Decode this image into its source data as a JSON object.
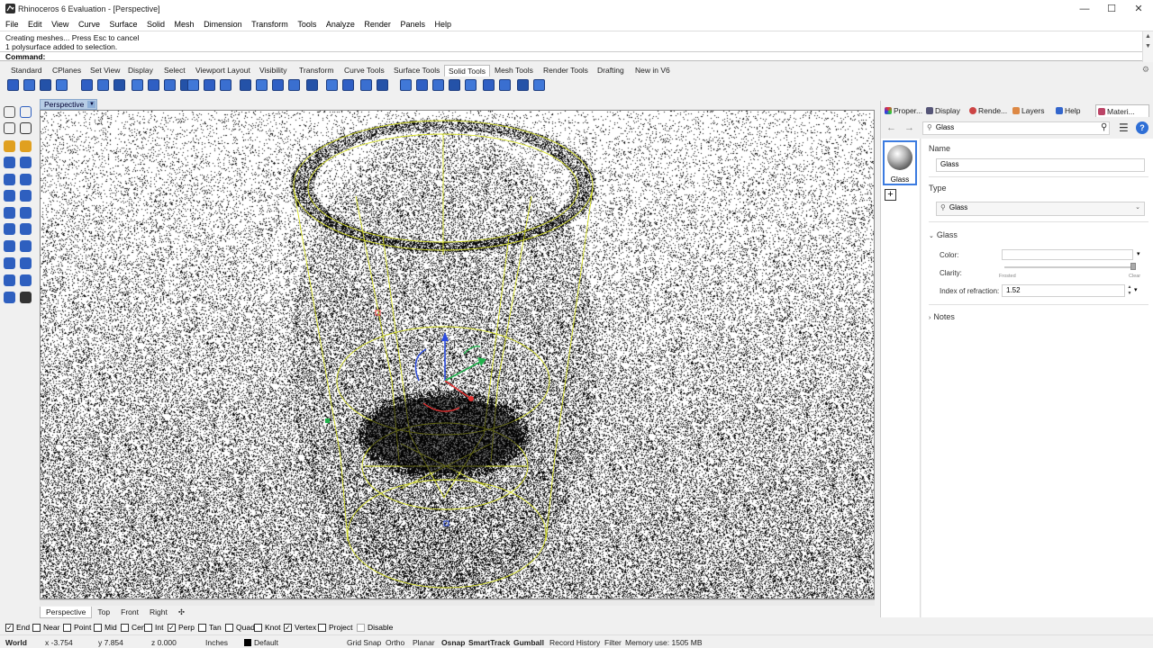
{
  "window": {
    "title": "Rhinoceros 6 Evaluation - [Perspective]",
    "controls": {
      "minimize": "—",
      "maximize": "☐",
      "close": "✕"
    }
  },
  "menu": [
    "File",
    "Edit",
    "View",
    "Curve",
    "Surface",
    "Solid",
    "Mesh",
    "Dimension",
    "Transform",
    "Tools",
    "Analyze",
    "Render",
    "Panels",
    "Help"
  ],
  "command_history": {
    "line1": "Creating meshes... Press Esc to cancel",
    "line2": "1 polysurface added to selection.",
    "prompt": "Command:"
  },
  "toolbar_tabs": {
    "items": [
      "Standard",
      "CPlanes",
      "Set View",
      "Display",
      "Select",
      "Viewport Layout",
      "Visibility",
      "Transform",
      "Curve Tools",
      "Surface Tools",
      "Solid Tools",
      "Mesh Tools",
      "Render Tools",
      "Drafting",
      "New in V6"
    ],
    "active": "Solid Tools"
  },
  "viewport": {
    "label": "Perspective",
    "dropdown": "▼",
    "bottom_tabs": [
      "Perspective",
      "Top",
      "Front",
      "Right"
    ],
    "add_tab": "✣"
  },
  "panel": {
    "tabs": [
      "Proper...",
      "Display",
      "Rende...",
      "Layers",
      "Help",
      "Materi..."
    ],
    "active_tab": "Materi...",
    "toolbar": {
      "back": "←",
      "forward": "→",
      "search_value": "Glass"
    },
    "material_thumbnail_label": "Glass",
    "add_button": "+",
    "name_section_label": "Name",
    "name_value": "Glass",
    "type_section_label": "Type",
    "type_value": "Glass",
    "glass_section_label": "Glass",
    "color_label": "Color:",
    "clarity_label": "Clarity:",
    "clarity_min_label": "Frosted",
    "clarity_max_label": "Clear",
    "ior_label": "Index of refraction:",
    "ior_value": "1.52",
    "notes_label": "Notes"
  },
  "osnaps": [
    {
      "label": "End",
      "checked": true
    },
    {
      "label": "Near",
      "checked": false
    },
    {
      "label": "Point",
      "checked": false
    },
    {
      "label": "Mid",
      "checked": false
    },
    {
      "label": "Cen",
      "checked": false
    },
    {
      "label": "Int",
      "checked": false
    },
    {
      "label": "Perp",
      "checked": true
    },
    {
      "label": "Tan",
      "checked": false
    },
    {
      "label": "Quad",
      "checked": false
    },
    {
      "label": "Knot",
      "checked": false
    },
    {
      "label": "Vertex",
      "checked": true
    },
    {
      "label": "Project",
      "checked": false
    },
    {
      "label": "Disable",
      "checked": false
    }
  ],
  "status": {
    "cplane": "World",
    "x": "x -3.754",
    "y": "y 7.854",
    "z": "z 0.000",
    "units": "Inches",
    "layer": "Default",
    "grid_snap": "Grid Snap",
    "ortho": "Ortho",
    "planar": "Planar",
    "osnap": "Osnap",
    "smarttrack": "SmartTrack",
    "gumball": "Gumball",
    "record_history": "Record History",
    "filter": "Filter",
    "memory": "Memory use: 1505 MB"
  }
}
